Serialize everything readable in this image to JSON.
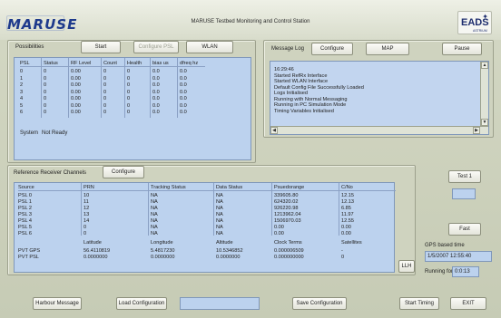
{
  "header": {
    "logo": "MARUSE",
    "title": "MARUSE Testbed Monitoring and Control Station",
    "eads": "EADS",
    "eads_sub": "ASTRIUM"
  },
  "possibilities": {
    "label": "Possibilities",
    "start_btn": "Start",
    "config_psl_btn": "Configure PSL",
    "wlan_btn": "WLAN",
    "columns": [
      "PSL",
      "Status",
      "RF Level",
      "Count",
      "Health",
      "bias us",
      "dfreq hz"
    ],
    "rows": [
      [
        "0",
        "0",
        "0.00",
        "0",
        "0",
        "0.0",
        "0.0"
      ],
      [
        "1",
        "0",
        "0.00",
        "0",
        "0",
        "0.0",
        "0.0"
      ],
      [
        "2",
        "0",
        "0.00",
        "0",
        "0",
        "0.0",
        "0.0"
      ],
      [
        "3",
        "0",
        "0.00",
        "0",
        "0",
        "0.0",
        "0.0"
      ],
      [
        "4",
        "0",
        "0.00",
        "0",
        "0",
        "0.0",
        "0.0"
      ],
      [
        "5",
        "0",
        "0.00",
        "0",
        "0",
        "0.0",
        "0.0"
      ],
      [
        "6",
        "0",
        "0.00",
        "0",
        "0",
        "0.0",
        "0.0"
      ]
    ],
    "system_label": "System",
    "system_status": "Not Ready"
  },
  "message_log": {
    "label": "Message Log",
    "configure_btn": "Configure",
    "map_btn": "MAP",
    "pause_btn": "Pause",
    "lines": [
      "16:29:46",
      "Started RefRx Interface",
      "Started WLAN Interface",
      "Default Config File Successfully Loaded",
      "Logs Initialised",
      "Running with Normal Messaging",
      "Running in PC Simulation Mode",
      "Timing Variables Initialised"
    ]
  },
  "reference": {
    "label": "Reference Receiver Channels",
    "configure_btn": "Configure",
    "columns": [
      "Source",
      "PRN",
      "Tracking Status",
      "Data Status",
      "Psuedorange",
      "C/No"
    ],
    "rows": [
      [
        "PSL 0",
        "10",
        "NA",
        "NA",
        "339605.80",
        "12.15"
      ],
      [
        "PSL 1",
        "11",
        "NA",
        "NA",
        "624320.02",
        "12.13"
      ],
      [
        "PSL 2",
        "12",
        "NA",
        "NA",
        "926220.98",
        "6.85"
      ],
      [
        "PSL 3",
        "13",
        "NA",
        "NA",
        "1213962.04",
        "11.97"
      ],
      [
        "PSL 4",
        "14",
        "NA",
        "NA",
        "1506970.03",
        "12.55"
      ],
      [
        "PSL 5",
        "0",
        "NA",
        "NA",
        "0.00",
        "0.00"
      ],
      [
        "PSL 6",
        "0",
        "NA",
        "NA",
        "0.00",
        "0.00"
      ]
    ],
    "pvt_columns": [
      "",
      "Latitude",
      "Longitude",
      "Altitude",
      "Clock Terms",
      "Satellites"
    ],
    "pvt_rows": [
      [
        "PVT GPS",
        "56.4110819",
        "5.4817230",
        "10.5346852",
        "0.000006509",
        "-"
      ],
      [
        "PVT PSL",
        "0.0000000",
        "0.0000000",
        "0.0000000",
        "0.000000000",
        "0"
      ]
    ],
    "llh_btn": "LLH"
  },
  "side": {
    "test_btn": "Test 1",
    "fast_btn": "Fast",
    "gps_label": "GPS based time",
    "gps_time": "1/5/2007 12:55:40",
    "running_label": "Running for",
    "running_value": "0:0:13"
  },
  "footer": {
    "harbour_btn": "Harbour Message",
    "load_btn": "Load Configuration",
    "save_btn": "Save Configuration",
    "start_timing_btn": "Start Timing",
    "exit_btn": "EXIT"
  }
}
